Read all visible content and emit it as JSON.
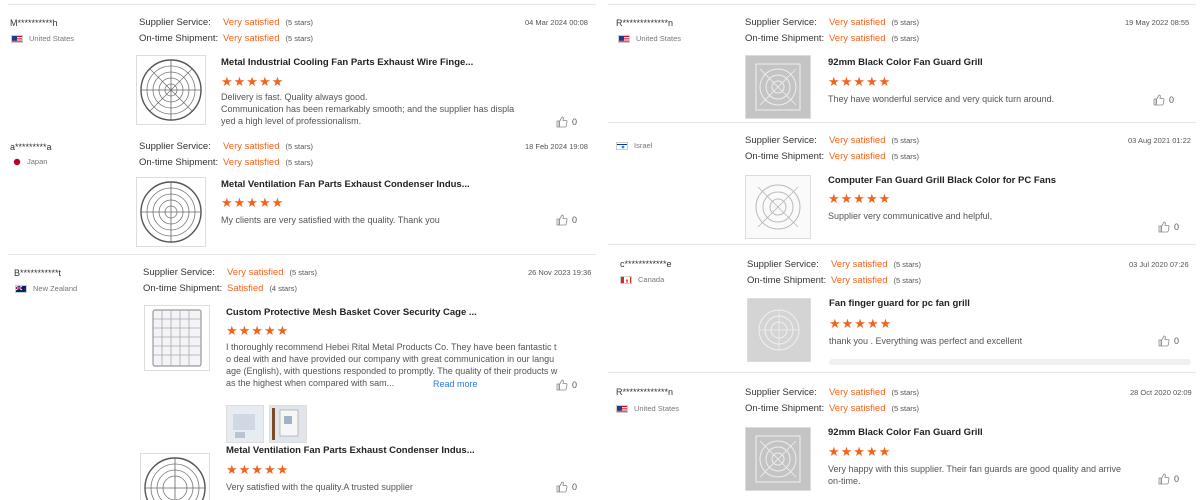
{
  "labels": {
    "supplier_service": "Supplier Service:",
    "on_time_shipment": "On-time Shipment:",
    "read_more": "Read more"
  },
  "colors": {
    "accent": "#f2641e",
    "link": "#2a7ae2"
  },
  "reviews_left": [
    {
      "user": "M**********h",
      "country": "United States",
      "flag": "us-flag",
      "date": "04 Mar 2024 00:08",
      "service": "Very satisfied",
      "service_stars": "(5 stars)",
      "shipment": "Very satisfied",
      "shipment_stars": "(5 stars)",
      "product": "Metal Industrial Cooling Fan Parts Exhaust Wire Finge...",
      "rating": 5,
      "text": "Delivery is fast. Quality always good.\nCommunication has been remarkably smooth; and the supplier has displa\nyed a high level of professionalism.",
      "likes": "0"
    },
    {
      "user": "a*********a",
      "country": "Japan",
      "flag": "jp-flag",
      "date": "18 Feb 2024 19:08",
      "service": "Very satisfied",
      "service_stars": "(5 stars)",
      "shipment": "Very satisfied",
      "shipment_stars": "(5 stars)",
      "product": "Metal Ventilation Fan Parts Exhaust Condenser Indus...",
      "rating": 5,
      "text": "My clients are very satisfied with the quality. Thank you",
      "likes": "0"
    },
    {
      "user": "B***********t",
      "country": "New Zealand",
      "flag": "nz-flag",
      "date": "26 Nov 2023 19:36",
      "service": "Very satisfied",
      "service_stars": "(5 stars)",
      "shipment": "Satisfied",
      "shipment_stars": "(4 stars)",
      "product": "Custom Protective Mesh Basket Cover Security Cage ...",
      "rating": 5,
      "text": "I thoroughly recommend Hebei Rital Metal Products Co. They have been fantastic t\no deal with and have provided our company with great communication in our langu\nage (English), with questions responded to promptly. The quality of their products w\nas the highest when compared with sam...",
      "likes": "0",
      "product2": "Metal Ventilation Fan Parts Exhaust Condenser Indus...",
      "rating2": 5,
      "text2": "Very satisfied with the quality.A trusted supplier",
      "likes2": "0"
    }
  ],
  "reviews_right": [
    {
      "user": "R*************n",
      "country": "United States",
      "flag": "us-flag",
      "date": "19 May 2022 08:55",
      "service": "Very satisfied",
      "service_stars": "(5 stars)",
      "shipment": "Very satisfied",
      "shipment_stars": "(5 stars)",
      "product": "92mm Black Color Fan Guard Grill",
      "rating": 5,
      "text": "They have wonderful service and very quick turn around.",
      "likes": "0"
    },
    {
      "user": "",
      "country": "Israel",
      "flag": "il-flag",
      "date": "03 Aug 2021 01:22",
      "service": "Very satisfied",
      "service_stars": "(5 stars)",
      "shipment": "Very satisfied",
      "shipment_stars": "(5 stars)",
      "product": "Computer Fan Guard Grill Black Color for PC Fans",
      "rating": 5,
      "text": "Supplier very communicative and helpful,",
      "likes": "0"
    },
    {
      "user": "c************e",
      "country": "Canada",
      "flag": "ca-flag",
      "date": "03 Jul 2020 07:26",
      "service": "Very satisfied",
      "service_stars": "(5 stars)",
      "shipment": "Very satisfied",
      "shipment_stars": "(5 stars)",
      "product": "Fan finger guard for pc fan grill",
      "rating": 5,
      "text": "thank you . Everything was perfect and excellent",
      "likes": "0"
    },
    {
      "user": "R*************n",
      "country": "United States",
      "flag": "us-flag",
      "date": "28 Oct 2020 02:09",
      "service": "Very satisfied",
      "service_stars": "(5 stars)",
      "shipment": "Very satisfied",
      "shipment_stars": "(5 stars)",
      "product": "92mm Black Color Fan Guard Grill",
      "rating": 5,
      "text": "Very happy with this supplier. Their fan guards are good quality and arrive\non-time.",
      "likes": "0"
    }
  ]
}
